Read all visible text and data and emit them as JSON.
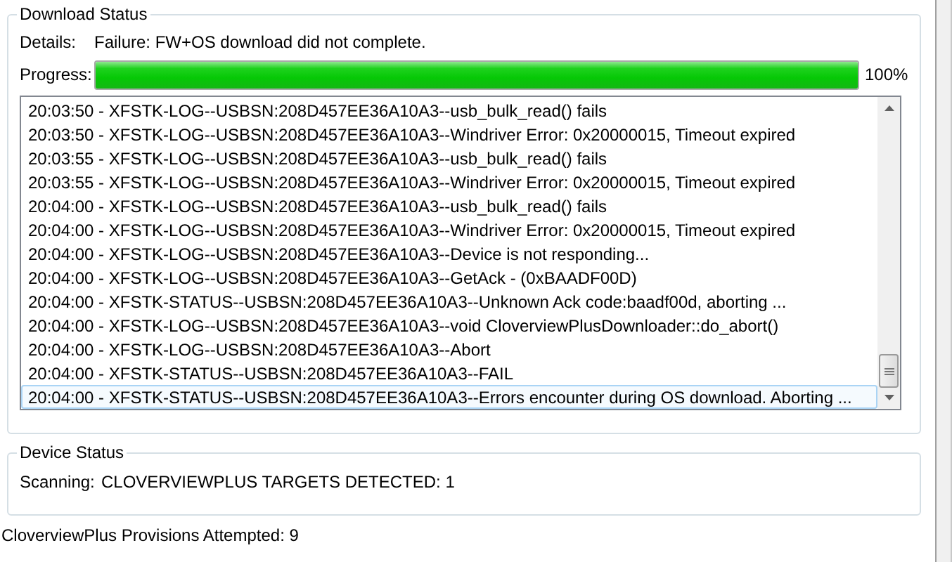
{
  "download_status": {
    "title": "Download Status",
    "details_label": "Details:",
    "details": "Failure: FW+OS download did not complete.",
    "progress_label": "Progress:",
    "progress": {
      "level": 1.0,
      "reading": "100%"
    },
    "log": [
      {
        "text": "20:03:50 - XFSTK-LOG--USBSN:208D457EE36A10A3--usb_bulk_read() fails",
        "selected": false
      },
      {
        "text": "20:03:50 - XFSTK-LOG--USBSN:208D457EE36A10A3--Windriver Error: 0x20000015, Timeout expired",
        "selected": false
      },
      {
        "text": "20:03:55 - XFSTK-LOG--USBSN:208D457EE36A10A3--usb_bulk_read() fails",
        "selected": false
      },
      {
        "text": "20:03:55 - XFSTK-LOG--USBSN:208D457EE36A10A3--Windriver Error: 0x20000015, Timeout expired",
        "selected": false
      },
      {
        "text": "20:04:00 - XFSTK-LOG--USBSN:208D457EE36A10A3--usb_bulk_read() fails",
        "selected": false
      },
      {
        "text": "20:04:00 - XFSTK-LOG--USBSN:208D457EE36A10A3--Windriver Error: 0x20000015, Timeout expired",
        "selected": false
      },
      {
        "text": "20:04:00 - XFSTK-LOG--USBSN:208D457EE36A10A3--Device is not responding...",
        "selected": false
      },
      {
        "text": "20:04:00 - XFSTK-LOG--USBSN:208D457EE36A10A3--GetAck - (0xBAADF00D)",
        "selected": false
      },
      {
        "text": "20:04:00 - XFSTK-STATUS--USBSN:208D457EE36A10A3--Unknown Ack code:baadf00d, aborting ...",
        "selected": false
      },
      {
        "text": "20:04:00 - XFSTK-LOG--USBSN:208D457EE36A10A3--void CloverviewPlusDownloader::do_abort()",
        "selected": false
      },
      {
        "text": "20:04:00 - XFSTK-LOG--USBSN:208D457EE36A10A3--Abort",
        "selected": false
      },
      {
        "text": "20:04:00 - XFSTK-STATUS--USBSN:208D457EE36A10A3--FAIL",
        "selected": false
      },
      {
        "text": "20:04:00 - XFSTK-STATUS--USBSN:208D457EE36A10A3--Errors encounter during OS download. Aborting ...",
        "selected": true
      }
    ]
  },
  "device_status": {
    "title": "Device Status",
    "scanning_label": "Scanning:",
    "scanning": "CLOVERVIEWPLUS TARGETS DETECTED: 1"
  },
  "footer": "CloverviewPlus Provisions Attempted: 9"
}
